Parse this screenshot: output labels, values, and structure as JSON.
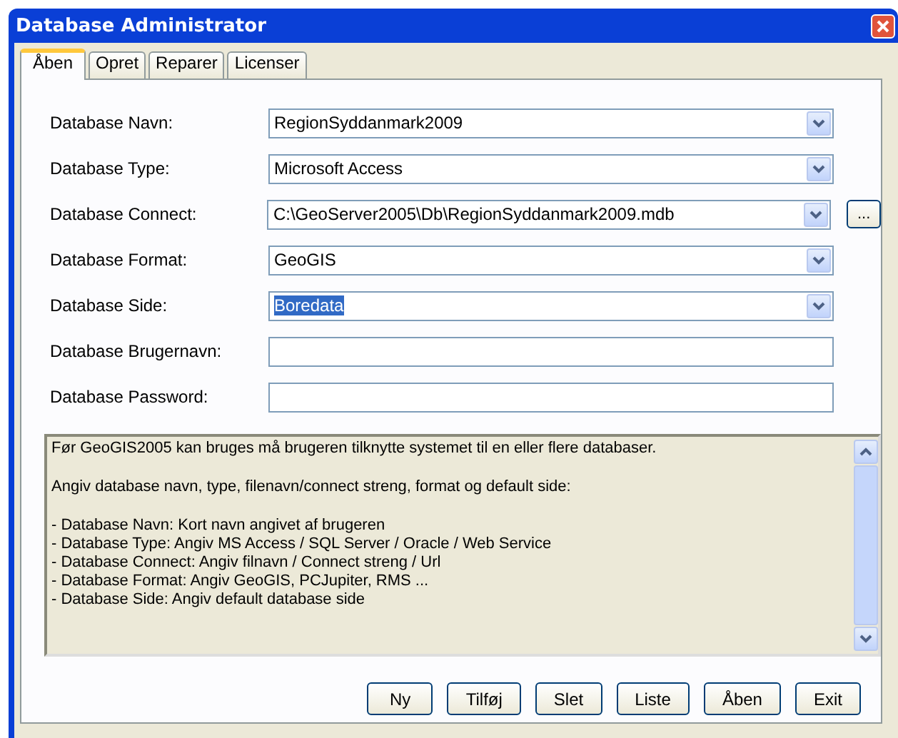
{
  "window": {
    "title": "Database Administrator"
  },
  "tabs": [
    {
      "label": "Åben",
      "selected": true
    },
    {
      "label": "Opret",
      "selected": false
    },
    {
      "label": "Reparer",
      "selected": false
    },
    {
      "label": "Licenser",
      "selected": false
    }
  ],
  "fields": [
    {
      "kind": "combo",
      "label": "Database Navn:",
      "value": "RegionSyddanmark2009",
      "text_selected": false
    },
    {
      "kind": "combo",
      "label": "Database Type:",
      "value": "Microsoft Access",
      "text_selected": false
    },
    {
      "kind": "combo",
      "label": "Database Connect:",
      "value": "C:\\GeoServer2005\\Db\\RegionSyddanmark2009.mdb",
      "text_selected": false,
      "browse_label": "..."
    },
    {
      "kind": "combo",
      "label": "Database Format:",
      "value": "GeoGIS",
      "text_selected": false
    },
    {
      "kind": "combo",
      "label": "Database Side:",
      "value": "Boredata",
      "text_selected": true
    },
    {
      "kind": "text",
      "label": "Database Brugernavn:"
    },
    {
      "kind": "text",
      "label": "Database Password:"
    }
  ],
  "help_paragraphs": [
    [
      "Før GeoGIS2005 kan bruges må brugeren tilknytte systemet til en eller flere databaser."
    ],
    [
      "Angiv database navn, type, filenavn/connect streng, format og default side:"
    ],
    [
      "- Database Navn: Kort navn angivet af brugeren",
      "- Database Type: Angiv MS Access / SQL Server / Oracle / Web Service",
      "- Database Connect: Angiv filnavn / Connect streng / Url",
      "- Database Format: Angiv GeoGIS, PCJupiter, RMS ...",
      "- Database Side: Angiv default database side"
    ]
  ],
  "buttons": [
    "Ny",
    "Tilføj",
    "Slet",
    "Liste",
    "Åben",
    "Exit"
  ]
}
